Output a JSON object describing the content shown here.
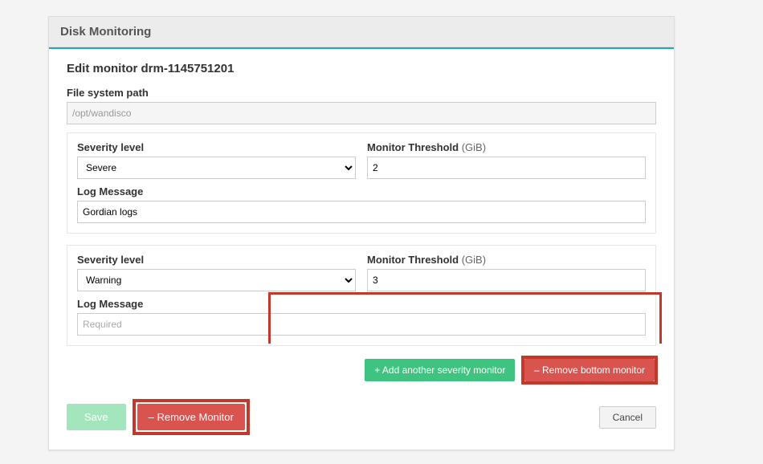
{
  "header": {
    "title": "Disk Monitoring"
  },
  "page": {
    "title": "Edit monitor drm-1145751201"
  },
  "fs_path": {
    "label": "File system path",
    "value": "/opt/wandisco"
  },
  "labels": {
    "severity": "Severity level",
    "threshold": "Monitor Threshold ",
    "threshold_unit": "(GiB)",
    "logmsg": "Log Message"
  },
  "monitors": [
    {
      "severity": "Severe",
      "threshold": "2",
      "log": "Gordian logs",
      "log_placeholder": ""
    },
    {
      "severity": "Warning",
      "threshold": "3",
      "log": "",
      "log_placeholder": "Required"
    }
  ],
  "severity_options": [
    "Severe",
    "Warning"
  ],
  "buttons": {
    "add": "+  Add another severity monitor",
    "remove_bottom": "–   Remove bottom monitor",
    "save": "Save",
    "remove_monitor": "– Remove Monitor",
    "cancel": "Cancel"
  }
}
